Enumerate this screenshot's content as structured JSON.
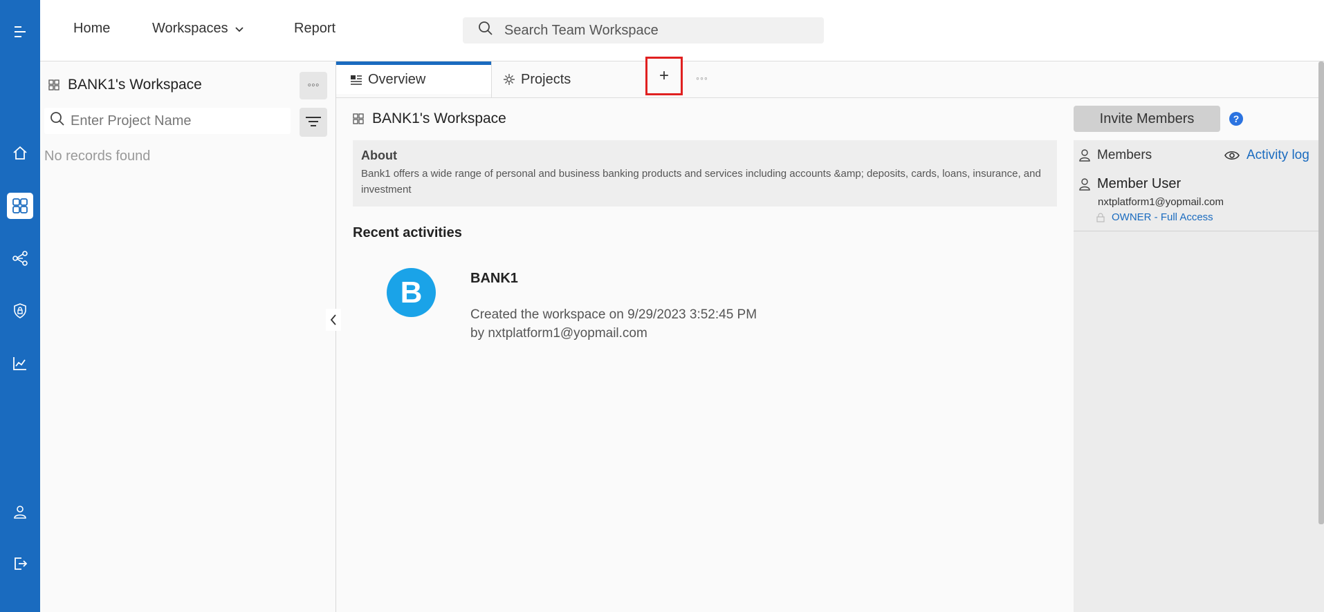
{
  "nav": {
    "home": "Home",
    "workspaces": "Workspaces",
    "report": "Report",
    "search_placeholder": "Search Team Workspace"
  },
  "sidebar": {
    "workspace_title": "BANK1's Workspace",
    "more_label": "◦◦◦",
    "project_search_placeholder": "Enter Project Name",
    "empty_text": "No records found"
  },
  "tabs": {
    "overview": "Overview",
    "projects": "Projects",
    "add_label": "+",
    "more_label": "◦◦◦"
  },
  "main": {
    "title": "BANK1's Workspace",
    "about_heading": "About",
    "about_text": "Bank1 offers a wide range of personal and business banking products and services including accounts &amp; deposits, cards, loans, insurance, and investment",
    "recent_heading": "Recent activities",
    "activity": {
      "avatar_letter": "B",
      "name": "BANK1",
      "line1": "Created the workspace on 9/29/2023 3:52:45 PM",
      "line2": "by nxtplatform1@yopmail.com"
    }
  },
  "members": {
    "invite_label": "Invite Members",
    "help_label": "?",
    "heading": "Members",
    "activity_log": "Activity log",
    "user": {
      "name": "Member User",
      "email": "nxtplatform1@yopmail.com",
      "role": "OWNER - Full Access"
    }
  },
  "colors": {
    "brand": "#1a6bbf",
    "highlight": "#e02020",
    "avatar": "#1aa3e8"
  }
}
